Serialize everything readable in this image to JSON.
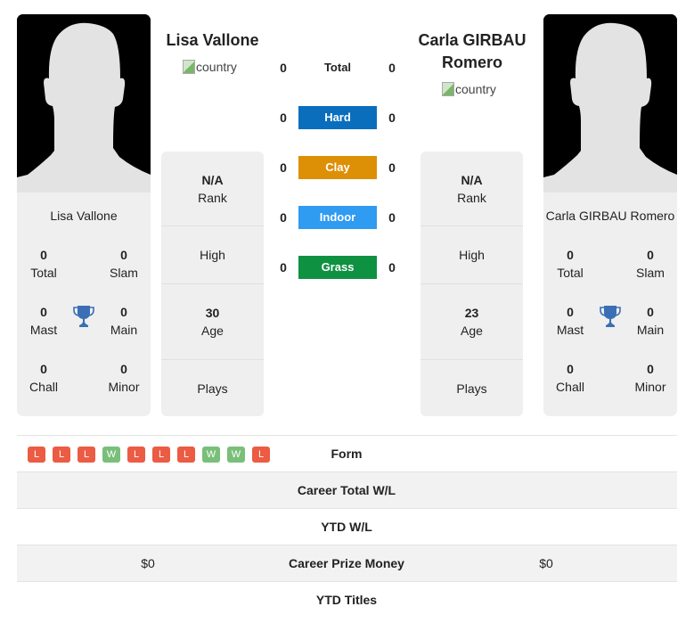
{
  "player1": {
    "name": "Lisa Vallone",
    "card_name": "Lisa Vallone",
    "flag_alt": "country",
    "titles": {
      "total": {
        "value": "0",
        "label": "Total"
      },
      "slam": {
        "value": "0",
        "label": "Slam"
      },
      "mast": {
        "value": "0",
        "label": "Mast"
      },
      "main": {
        "value": "0",
        "label": "Main"
      },
      "chall": {
        "value": "0",
        "label": "Chall"
      },
      "minor": {
        "value": "0",
        "label": "Minor"
      }
    },
    "info": {
      "rank": {
        "value": "N/A",
        "label": "Rank"
      },
      "high": {
        "label": "High"
      },
      "age": {
        "value": "30",
        "label": "Age"
      },
      "plays": {
        "label": "Plays"
      }
    },
    "prize_money": "$0"
  },
  "player2": {
    "name": "Carla GIRBAU Romero",
    "card_name": "Carla GIRBAU Romero",
    "flag_alt": "country",
    "titles": {
      "total": {
        "value": "0",
        "label": "Total"
      },
      "slam": {
        "value": "0",
        "label": "Slam"
      },
      "mast": {
        "value": "0",
        "label": "Mast"
      },
      "main": {
        "value": "0",
        "label": "Main"
      },
      "chall": {
        "value": "0",
        "label": "Chall"
      },
      "minor": {
        "value": "0",
        "label": "Minor"
      }
    },
    "info": {
      "rank": {
        "value": "N/A",
        "label": "Rank"
      },
      "high": {
        "label": "High"
      },
      "age": {
        "value": "23",
        "label": "Age"
      },
      "plays": {
        "label": "Plays"
      }
    },
    "prize_money": "$0"
  },
  "h2h": {
    "total": {
      "label": "Total",
      "p1": "0",
      "p2": "0"
    },
    "surfaces": [
      {
        "label": "Hard",
        "p1": "0",
        "p2": "0",
        "color": "#0a6ebd"
      },
      {
        "label": "Clay",
        "p1": "0",
        "p2": "0",
        "color": "#dd8f06"
      },
      {
        "label": "Indoor",
        "p1": "0",
        "p2": "0",
        "color": "#2f9bf1"
      },
      {
        "label": "Grass",
        "p1": "0",
        "p2": "0",
        "color": "#0f9142"
      }
    ]
  },
  "form": [
    "L",
    "L",
    "L",
    "W",
    "L",
    "L",
    "L",
    "W",
    "W",
    "L"
  ],
  "stats": {
    "form_label": "Form",
    "career_wl_label": "Career Total W/L",
    "ytd_wl_label": "YTD W/L",
    "prize_label": "Career Prize Money",
    "ytd_titles_label": "YTD Titles"
  },
  "colors": {
    "loss": "#ec5b43",
    "win": "#79bf7a",
    "trophy": "#3a6fb5",
    "card_bg": "#efefef"
  }
}
